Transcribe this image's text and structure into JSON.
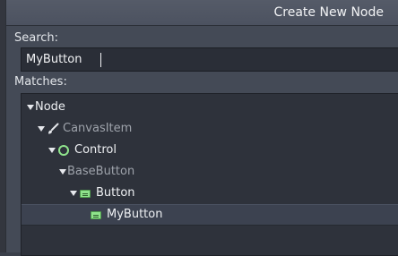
{
  "dialog": {
    "title": "Create New Node",
    "search_label": "Search:",
    "search_value": "MyButton",
    "matches_label": "Matches:"
  },
  "tree": {
    "items": [
      {
        "label": "Node",
        "icon": "none",
        "expanded": true
      },
      {
        "label": "CanvasItem",
        "icon": "brush-icon",
        "expanded": true
      },
      {
        "label": "Control",
        "icon": "control-circle-icon",
        "expanded": true
      },
      {
        "label": "BaseButton",
        "icon": "none",
        "expanded": true
      },
      {
        "label": "Button",
        "icon": "button-icon",
        "expanded": true
      },
      {
        "label": "MyButton",
        "icon": "button-icon",
        "selected": true
      }
    ]
  },
  "colors": {
    "accent_green": "#8fe38c",
    "selection_bg": "#3c4250",
    "panel_bg": "#444a56"
  }
}
